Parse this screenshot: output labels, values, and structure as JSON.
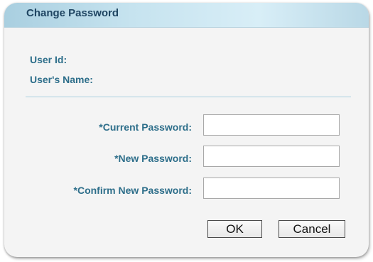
{
  "dialog": {
    "title": "Change Password"
  },
  "info": {
    "user_id_label": "User Id:",
    "user_name_label": "User's Name:"
  },
  "fields": {
    "current_password": {
      "label": "*Current Password:",
      "value": "",
      "placeholder": ""
    },
    "new_password": {
      "label": "*New Password:",
      "value": "",
      "placeholder": ""
    },
    "confirm_new_password": {
      "label": "*Confirm New Password:",
      "value": "",
      "placeholder": ""
    }
  },
  "buttons": {
    "ok_label": "OK",
    "cancel_label": "Cancel"
  },
  "colors": {
    "title_bar": "#c6e3ef",
    "title_text": "#1f4562",
    "label_text": "#2d6e8a",
    "divider": "#a9cfe0",
    "dialog_bg": "#f4f4f4"
  }
}
